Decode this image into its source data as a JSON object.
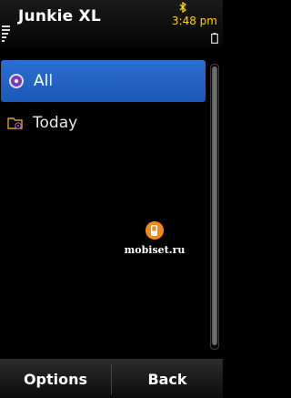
{
  "statusbar": {
    "title": "Junkie XL",
    "clock": "3:48 pm",
    "clock_color": "#ffd400"
  },
  "list": {
    "items": [
      {
        "label": "All",
        "icon": "disc-icon",
        "selected": true
      },
      {
        "label": "Today",
        "icon": "folder-icon",
        "selected": false
      }
    ]
  },
  "watermark": {
    "text": "mobiset.ru"
  },
  "softkeys": {
    "left": "Options",
    "right": "Back"
  },
  "colors": {
    "selection": "#2a6fd0",
    "background": "#000000"
  }
}
